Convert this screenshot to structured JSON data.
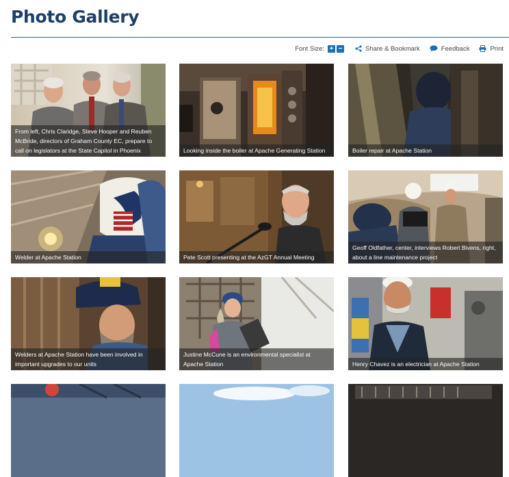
{
  "page": {
    "title": "Photo Gallery"
  },
  "toolbar": {
    "font_size_label": "Font Size:",
    "increase_icon": "+",
    "decrease_icon": "−",
    "share_label": "Share & Bookmark",
    "feedback_label": "Feedback",
    "print_label": "Print"
  },
  "gallery": {
    "items": [
      {
        "caption": "From left, Chris Claridge, Steve Hooper and Reuben McBride, directors of Graham County EC, prepare to call on legislators at the State Capitol in Phoenix"
      },
      {
        "caption": "Looking inside the boiler at Apache Generating Station"
      },
      {
        "caption": "Boiler repair at Apache Station"
      },
      {
        "caption": "Welder at Apache Station"
      },
      {
        "caption": "Pete Scott presenting at the AzGT Annual Meeting"
      },
      {
        "caption": "Geoff Oldfather, center, interviews Robert Bivens, right, about a line maintenance project"
      },
      {
        "caption": "Welders at Apache Station have been involved in important upgrades to our units"
      },
      {
        "caption": "Justine McCune is an environmental specialist at Apache Station"
      },
      {
        "caption": "Henry Chavez is an electrician at Apache Station"
      }
    ]
  },
  "colors": {
    "title": "#1d3f66",
    "accent": "#1e6fb8",
    "caption_bg": "#232323"
  }
}
